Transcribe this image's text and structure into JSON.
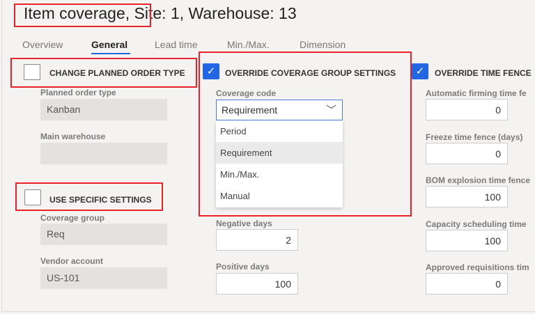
{
  "header": {
    "title_part1": "Item coverage,",
    "title_part2": " Site: 1, Warehouse: 13"
  },
  "tabs": [
    {
      "label": "Overview"
    },
    {
      "label": "General",
      "selected": true
    },
    {
      "label": "Lead time"
    },
    {
      "label": "Min./Max."
    },
    {
      "label": "Dimension"
    }
  ],
  "sections": {
    "change_planned_order_type": {
      "label": "CHANGE PLANNED ORDER TYPE",
      "checked": false
    },
    "override_coverage_group": {
      "label": "OVERRIDE COVERAGE GROUP SETTINGS",
      "checked": true
    },
    "override_time_fence": {
      "label": "OVERRIDE TIME FENCE",
      "checked": true
    },
    "use_specific_settings": {
      "label": "USE SPECIFIC SETTINGS",
      "checked": false
    }
  },
  "left": {
    "planned_order_type": {
      "label": "Planned order type",
      "value": "Kanban"
    },
    "main_warehouse": {
      "label": "Main warehouse",
      "value": ""
    },
    "coverage_group": {
      "label": "Coverage group",
      "value": "Req"
    },
    "vendor_account": {
      "label": "Vendor account",
      "value": "US-101"
    }
  },
  "middle": {
    "coverage_code": {
      "label": "Coverage code",
      "value": "Requirement",
      "options": [
        "Period",
        "Requirement",
        "Min./Max.",
        "Manual"
      ],
      "highlighted": "Requirement"
    },
    "negative_days": {
      "label": "Negative days",
      "value": "2"
    },
    "positive_days": {
      "label": "Positive days",
      "value": "100"
    }
  },
  "right": [
    {
      "label": "Automatic firming time fe",
      "value": "0"
    },
    {
      "label": "Freeze time fence (days)",
      "value": "0"
    },
    {
      "label": "BOM explosion time fence",
      "value": "100"
    },
    {
      "label": "Capacity scheduling time",
      "value": "100"
    },
    {
      "label": "Approved requisitions tim",
      "value": "0"
    }
  ],
  "colors": {
    "accent": "#2266e3",
    "highlight_box": "#e8222a"
  }
}
